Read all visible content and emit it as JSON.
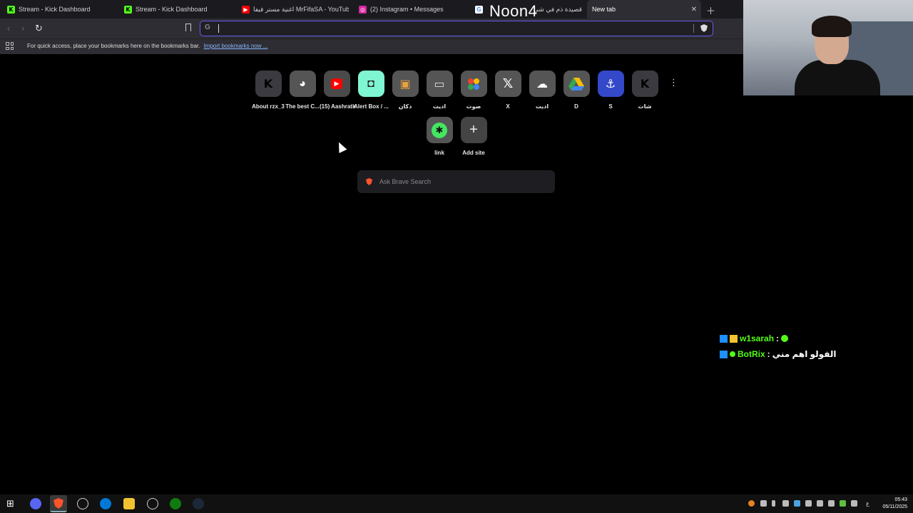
{
  "browser": {
    "tabs": [
      {
        "title": "Stream - Kick Dashboard",
        "icon": "kick-icon"
      },
      {
        "title": "Stream - Kick Dashboard",
        "icon": "kick-icon"
      },
      {
        "title": "اغنية مستر فيفا MrFifaSA - YouTube",
        "icon": "youtube-icon"
      },
      {
        "title": "(2) Instagram • Messages",
        "icon": "instagram-icon"
      },
      {
        "title": "قصيدة ذم في شي",
        "icon": "google-icon"
      },
      {
        "title": "New tab",
        "icon": ""
      }
    ],
    "overlay_title": "Noon4",
    "address_placeholder": "",
    "bookmarks_hint": "For quick access, place your bookmarks here on the bookmarks bar.",
    "bookmarks_import_link": "Import bookmarks now ..."
  },
  "speed_dials": {
    "row1": [
      {
        "label": "About rzx_3",
        "icon": "kick-icon"
      },
      {
        "label": "The best C...",
        "icon": "ghost-icon"
      },
      {
        "label": "(15) Aashratk",
        "icon": "youtube-icon"
      },
      {
        "label": "Alert Box / ...",
        "icon": "streamlabs-icon"
      },
      {
        "label": "دكان",
        "icon": "shopping-bag-icon"
      },
      {
        "label": "اديت",
        "icon": "tv-icon"
      },
      {
        "label": "صوت",
        "icon": "dots-icon"
      },
      {
        "label": "X",
        "icon": "x-icon"
      },
      {
        "label": "اديت",
        "icon": "cloud-icon"
      },
      {
        "label": "D",
        "icon": "drive-icon"
      },
      {
        "label": "S",
        "icon": "anchor-icon"
      },
      {
        "label": "شات",
        "icon": "kick-icon"
      }
    ],
    "row2": [
      {
        "label": "link",
        "icon": "linktree-icon"
      },
      {
        "label": "Add site",
        "icon": "plus-icon"
      }
    ]
  },
  "search": {
    "placeholder": "Ask Brave Search"
  },
  "chat": [
    {
      "user": "w1sarah",
      "sep": ":",
      "message": ""
    },
    {
      "user": "BotRix",
      "sep": ":",
      "message": "الفولو اهم مني"
    }
  ],
  "taskbar": {
    "time": "05:43",
    "date": "05/11/2025",
    "lang": "ع"
  },
  "colors": {
    "accent": "#6b5cf0",
    "kick_green": "#53fc18",
    "background": "#000000"
  }
}
